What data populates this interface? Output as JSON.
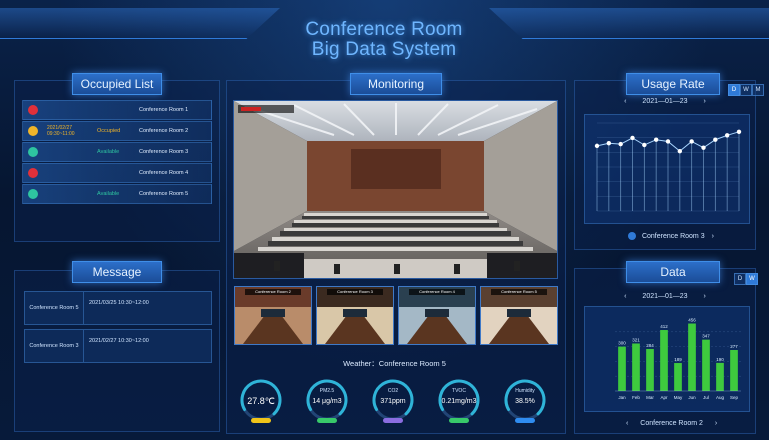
{
  "header": {
    "title_line1": "Conference Room",
    "title_line2": "Big Data System"
  },
  "occupied": {
    "title": "Occupied List",
    "rows": [
      {
        "dot_color": "#e0303a",
        "time": "",
        "status": "",
        "status_color": "#e0303a",
        "room": "Conference Room 1"
      },
      {
        "dot_color": "#f0b429",
        "time": "2021/02/27 09:30~11:00",
        "status": "Occupied",
        "status_color": "#f0b429",
        "room": "Conference Room 2"
      },
      {
        "dot_color": "#2ec4a0",
        "time": "",
        "status": "Available",
        "status_color": "#2ec4a0",
        "room": "Conference Room 3"
      },
      {
        "dot_color": "#e0303a",
        "time": "",
        "status": "",
        "status_color": "#e0303a",
        "room": "Conference Room 4"
      },
      {
        "dot_color": "#2ec4a0",
        "time": "",
        "status": "Available",
        "status_color": "#2ec4a0",
        "room": "Conference Room 5"
      }
    ]
  },
  "message": {
    "title": "Message",
    "rows": [
      {
        "room": "Conference Room 5",
        "time": "2021/03/25 10:30~12:00"
      },
      {
        "room": "Conference Room 3",
        "time": "2021/02/27 10:30~12:00"
      }
    ]
  },
  "monitoring": {
    "title": "Monitoring",
    "thumbnails": [
      "Conference Room 2",
      "Conference Room 3",
      "Conference Room 4",
      "Conference Room 5"
    ],
    "weather_label": "Weather：Conference Room 5",
    "gauges": [
      {
        "label": "",
        "value": "27.8℃",
        "indicator_color": "#f0c419",
        "ring_color": "#2fb4d8"
      },
      {
        "label": "PM2.5",
        "value": "14 μg/m3",
        "indicator_color": "#38c96a",
        "ring_color": "#2fb4d8"
      },
      {
        "label": "CO2",
        "value": "371ppm",
        "indicator_color": "#8b6de0",
        "ring_color": "#2fb4d8"
      },
      {
        "label": "TVOC",
        "value": "0.21mg/m3",
        "indicator_color": "#38c96a",
        "ring_color": "#2fb4d8"
      },
      {
        "label": "Humidity",
        "value": "38.5%",
        "indicator_color": "#2f8cf0",
        "ring_color": "#2fb4d8"
      }
    ]
  },
  "usage": {
    "title": "Usage Rate",
    "date": "2021—01—23",
    "prev_symbol": "‹",
    "next_symbol": "›",
    "toggles": [
      "D",
      "W",
      "M"
    ],
    "active_toggle": 0,
    "room": "Conference Room 3",
    "room_arrow": "›"
  },
  "data_panel": {
    "title": "Data",
    "date": "2021—01—23",
    "prev_symbol": "‹",
    "next_symbol": "›",
    "toggles": [
      "D",
      "W"
    ],
    "active_toggle": 1,
    "room": "Conference Room 2",
    "room_prev": "‹",
    "room_next": "›"
  },
  "chart_data": [
    {
      "type": "line",
      "title": "Usage Rate",
      "x": [
        "",
        "",
        "",
        "",
        "",
        "",
        "",
        "",
        "",
        "",
        "",
        "",
        ""
      ],
      "series": [
        {
          "values": [
            74,
            77,
            76,
            83,
            75,
            81,
            79,
            68,
            79,
            72,
            81,
            86,
            90
          ],
          "color": "#a9d6ff"
        }
      ],
      "ylim": [
        0,
        100
      ],
      "grid": true
    },
    {
      "type": "bar",
      "title": "Data",
      "categories": [
        "Jan",
        "Feb",
        "Mar",
        "Apr",
        "May",
        "Jun",
        "Jul",
        "Aug",
        "Sep"
      ],
      "values": [
        300,
        321,
        284,
        412,
        189,
        456,
        347,
        190,
        277
      ],
      "value_labels": [
        "300",
        "321",
        "284",
        "412",
        "189",
        "456",
        "347",
        "190",
        "277"
      ],
      "y_ticks": [
        "",
        "",
        "",
        ""
      ],
      "ylim": [
        0,
        500
      ],
      "bar_color": "#3ec93e",
      "grid": true
    }
  ]
}
